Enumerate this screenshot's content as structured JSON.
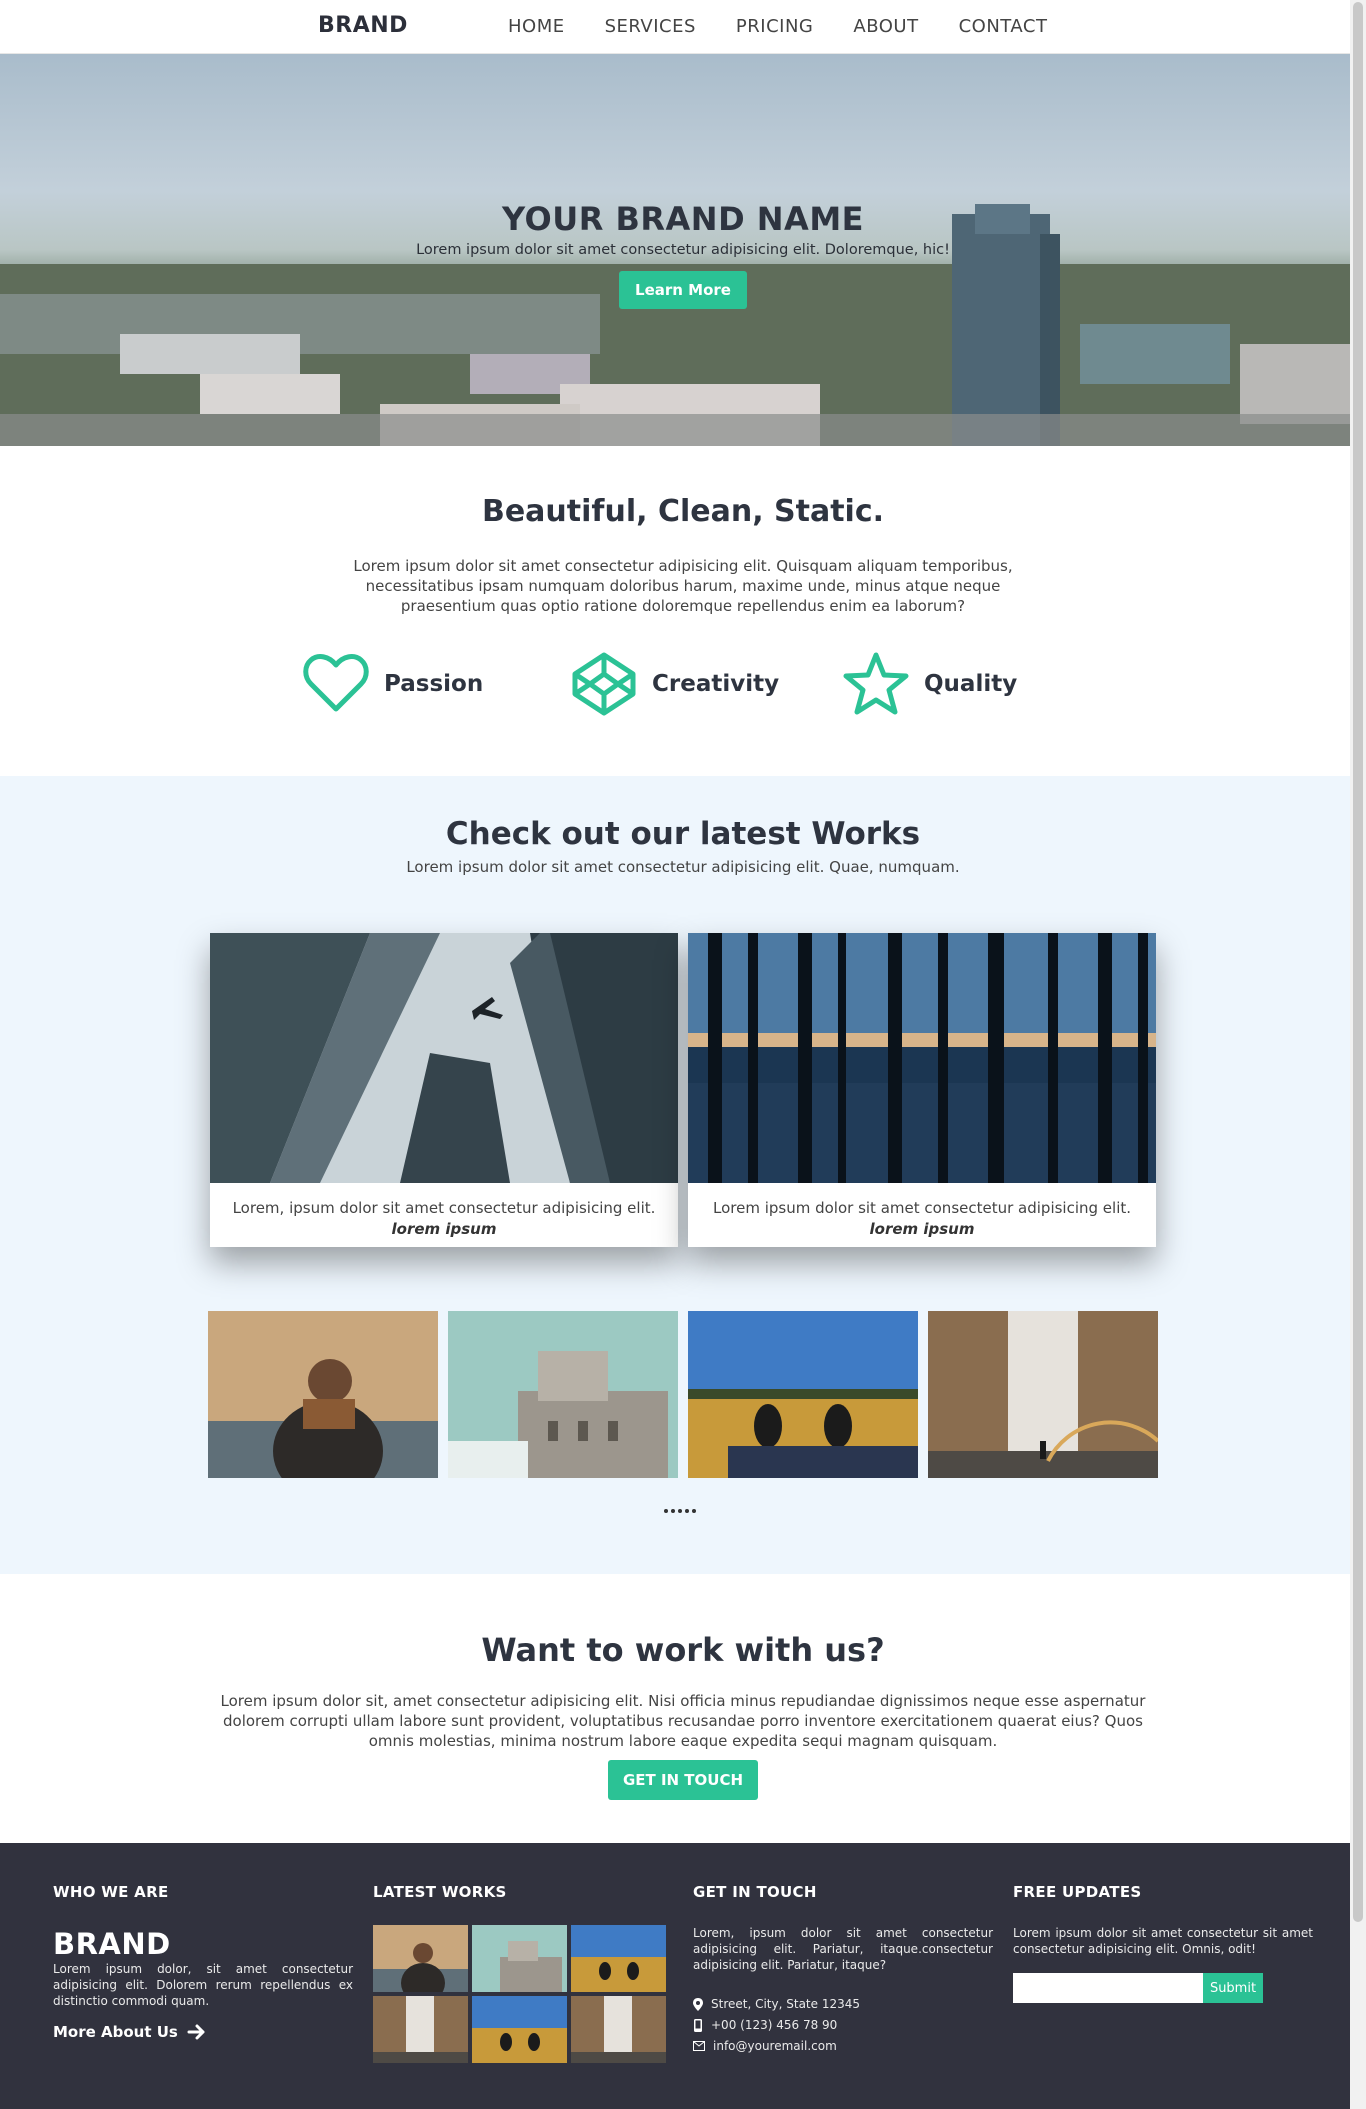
{
  "nav": {
    "brand": "BRAND",
    "links": [
      "HOME",
      "SERVICES",
      "PRICING",
      "ABOUT",
      "CONTACT"
    ]
  },
  "hero": {
    "title": "YOUR BRAND NAME",
    "subtitle": "Lorem ipsum dolor sit amet consectetur adipisicing elit. Doloremque, hic!",
    "button": "Learn More"
  },
  "features": {
    "title": "Beautiful, Clean, Static.",
    "text": "Lorem ipsum dolor sit amet consectetur adipisicing elit. Quisquam aliquam temporibus, necessitatibus ipsam numquam doloribus harum, maxime unde, minus atque neque praesentium quas optio ratione doloremque repellendus enim ea laborum?",
    "items": [
      {
        "label": "Passion",
        "icon": "heart-icon"
      },
      {
        "label": "Creativity",
        "icon": "codepen-icon"
      },
      {
        "label": "Quality",
        "icon": "star-icon"
      }
    ]
  },
  "works": {
    "title": "Check out our latest Works",
    "subtitle": "Lorem ipsum dolor sit amet consectetur adipisicing elit. Quae, numquam.",
    "cards": [
      {
        "caption": "Lorem, ipsum dolor sit amet consectetur adipisicing elit.",
        "author": "lorem ipsum"
      },
      {
        "caption": "Lorem ipsum dolor sit amet consectetur adipisicing elit.",
        "author": "lorem ipsum"
      }
    ],
    "more": "....."
  },
  "cta": {
    "title": "Want to work with us?",
    "text": "Lorem ipsum dolor sit, amet consectetur adipisicing elit. Nisi officia minus repudiandae dignissimos neque esse aspernatur dolorem corrupti ullam labore sunt provident, voluptatibus recusandae porro inventore exercitationem quaerat eius? Quos omnis molestias, minima nostrum labore eaque expedita sequi magnam quisquam.",
    "button": "GET IN TOUCH"
  },
  "footer": {
    "who": {
      "heading": "WHO WE ARE",
      "brand": "BRAND",
      "text": "Lorem ipsum dolor, sit amet consectetur adipisicing elit. Dolorem rerum repellendus ex distinctio commodi quam.",
      "link": "More About Us"
    },
    "latest": {
      "heading": "LATEST WORKS"
    },
    "contact": {
      "heading": "GET IN TOUCH",
      "text": "Lorem, ipsum dolor sit amet consectetur adipisicing elit. Pariatur, itaque.consectetur adipisicing elit. Pariatur, itaque?",
      "address": "Street, City, State 12345",
      "phone": "+00 (123) 456 78 90",
      "email": "info@youremail.com"
    },
    "updates": {
      "heading": "FREE UPDATES",
      "text": "Lorem ipsum dolor sit amet consectetur sit amet consectetur adipisicing elit. Omnis, odit!",
      "input_placeholder": "",
      "button": "Submit"
    }
  },
  "colors": {
    "accent": "#2bc295",
    "dark": "#31323e",
    "works_bg": "#eef6fd"
  }
}
